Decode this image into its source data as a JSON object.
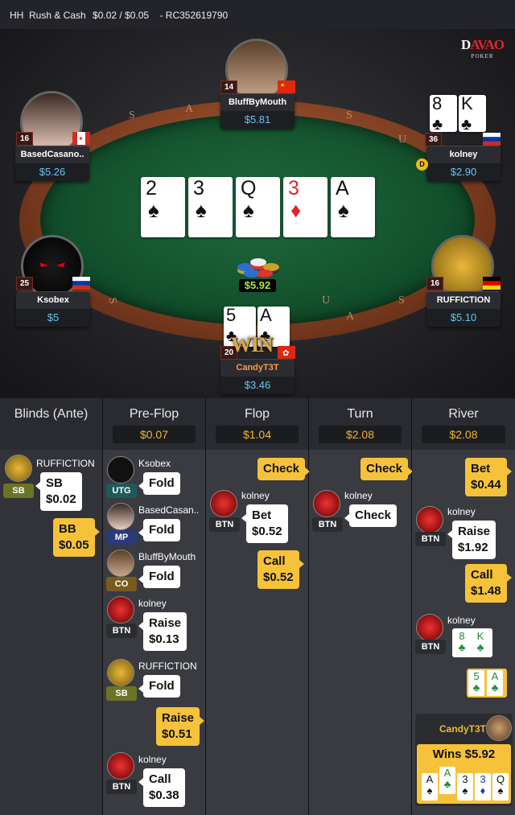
{
  "header": {
    "game": "HH  Rush & Cash",
    "stakes": "$0.02 / $0.05",
    "hand_id": "- RC352619790"
  },
  "logo": {
    "line1_a": "D",
    "line1_b": "AVAO",
    "line2": "POKER"
  },
  "table": {
    "rail_letters": [
      "S",
      "A",
      "S",
      "U",
      "A",
      "S",
      "U",
      "S",
      "A"
    ],
    "board": [
      {
        "rank": "2",
        "suit": "♠",
        "color": "black"
      },
      {
        "rank": "3",
        "suit": "♠",
        "color": "black"
      },
      {
        "rank": "Q",
        "suit": "♠",
        "color": "black"
      },
      {
        "rank": "3",
        "suit": "♦",
        "color": "red"
      },
      {
        "rank": "A",
        "suit": "♠",
        "color": "black"
      }
    ],
    "pot": "$5.92",
    "win_text": "WIN",
    "dealer_label": "D"
  },
  "seats": {
    "bluff": {
      "name": "BluffByMouth",
      "stack": "$5.81",
      "level": "14"
    },
    "based": {
      "name": "BasedCasano..",
      "stack": "$5.26",
      "level": "16"
    },
    "kolney": {
      "name": "kolney",
      "stack": "$2.90",
      "level": "36",
      "card1": "8",
      "card1_suit": "♣",
      "card2": "K",
      "card2_suit": "♣"
    },
    "ksobex": {
      "name": "Ksobex",
      "stack": "$5",
      "level": "25"
    },
    "ruff": {
      "name": "RUFFICTION",
      "stack": "$5.10",
      "level": "16"
    },
    "candy": {
      "name": "CandyT3T",
      "stack": "$3.46",
      "level": "20",
      "card1": "5",
      "card1_suit": "♣",
      "card2": "A",
      "card2_suit": "♣"
    }
  },
  "history": {
    "columns": [
      {
        "title": "Blinds (Ante)",
        "pot": ""
      },
      {
        "title": "Pre-Flop",
        "pot": "$0.07"
      },
      {
        "title": "Flop",
        "pot": "$1.04"
      },
      {
        "title": "Turn",
        "pot": "$2.08"
      },
      {
        "title": "River",
        "pot": "$2.08"
      }
    ],
    "blinds": {
      "p1": {
        "name": "RUFFICTION",
        "pos": "SB",
        "action": "SB",
        "amount": "$0.02"
      },
      "p2": {
        "action": "BB",
        "amount": "$0.05"
      }
    },
    "preflop": [
      {
        "name": "Ksobex",
        "pos": "UTG",
        "action": "Fold"
      },
      {
        "name": "BasedCasan..",
        "pos": "MP",
        "action": "Fold"
      },
      {
        "name": "BluffByMouth",
        "pos": "CO",
        "action": "Fold"
      },
      {
        "name": "kolney",
        "pos": "BTN",
        "action": "Raise",
        "amount": "$0.13"
      },
      {
        "name": "RUFFICTION",
        "pos": "SB",
        "action": "Fold"
      },
      {
        "hero_action": "Raise",
        "hero_amount": "$0.51"
      },
      {
        "name": "kolney",
        "pos": "BTN",
        "action": "Call",
        "amount": "$0.38"
      }
    ],
    "flop": {
      "hero1": "Check",
      "p": {
        "name": "kolney",
        "pos": "BTN",
        "action": "Bet",
        "amount": "$0.52"
      },
      "hero2": "Call",
      "hero2_amount": "$0.52"
    },
    "turn": {
      "hero1": "Check",
      "p": {
        "name": "kolney",
        "pos": "BTN",
        "action": "Check"
      }
    },
    "river": {
      "hero1": "Bet",
      "hero1_amount": "$0.44",
      "p1": {
        "name": "kolney",
        "pos": "BTN",
        "action": "Raise",
        "amount": "$1.92"
      },
      "hero2": "Call",
      "hero2_amount": "$1.48",
      "p2": {
        "name": "kolney",
        "pos": "BTN"
      },
      "show_kolney": [
        "8",
        "K"
      ],
      "show_hero": [
        "5",
        "A"
      ],
      "winner": "CandyT3T",
      "wins": "Wins $5.92",
      "final": [
        {
          "rank": "A",
          "suit": "♠"
        },
        {
          "rank": "A",
          "suit": "♣"
        },
        {
          "rank": "3",
          "suit": "♠"
        },
        {
          "rank": "3",
          "suit": "♦"
        },
        {
          "rank": "Q",
          "suit": "♠"
        }
      ]
    }
  }
}
